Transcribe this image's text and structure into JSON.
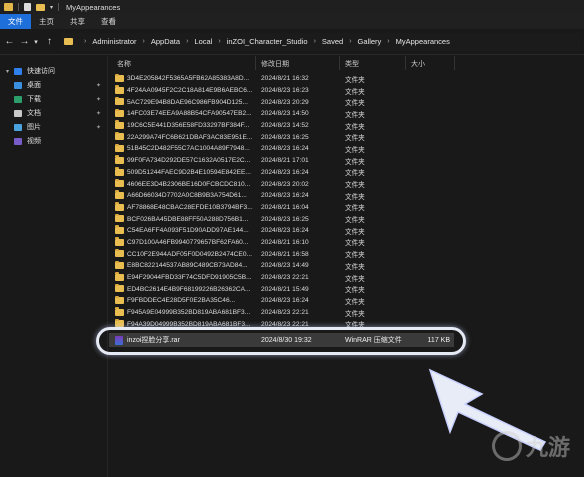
{
  "window": {
    "title": "MyAppearances"
  },
  "ribbon": {
    "tabs": [
      "文件",
      "主页",
      "共享",
      "查看"
    ],
    "active": 0
  },
  "breadcrumbs": [
    "Administrator",
    "AppData",
    "Local",
    "inZOI_Character_Studio",
    "Saved",
    "Gallery",
    "MyAppearances"
  ],
  "sidebar": {
    "quick_access": "快速访问",
    "items": [
      "桌面",
      "下载",
      "文档",
      "图片",
      "视频"
    ]
  },
  "columns": {
    "name": "名称",
    "date": "修改日期",
    "type": "类型",
    "size": "大小"
  },
  "files": [
    {
      "name": "3D4E205842F5365A5FB62A85383A8D...",
      "date": "2024/8/21 16:32",
      "type": "文件夹"
    },
    {
      "name": "4F24AA0945F2C2C18A814E9B6AEBC6...",
      "date": "2024/8/23 16:23",
      "type": "文件夹"
    },
    {
      "name": "5AC729E94B8DAE96C986FB904D125...",
      "date": "2024/8/23 20:29",
      "type": "文件夹"
    },
    {
      "name": "14FC03E74EEA9A88B54CFA90547EB2...",
      "date": "2024/8/23 14:50",
      "type": "文件夹"
    },
    {
      "name": "19C6C5E441D356E58FD33297BF384F...",
      "date": "2024/8/23 14:52",
      "type": "文件夹"
    },
    {
      "name": "22A299A74FC6B621DBAF3AC83E951E...",
      "date": "2024/8/23 16:25",
      "type": "文件夹"
    },
    {
      "name": "51B45C2D482F55C7AC1004A89F7948...",
      "date": "2024/8/23 16:24",
      "type": "文件夹"
    },
    {
      "name": "99F0FA734D292DE57C1632A0517E2C...",
      "date": "2024/8/21 17:01",
      "type": "文件夹"
    },
    {
      "name": "509D51244FAEC9D2B4E10594E842EE...",
      "date": "2024/8/23 16:24",
      "type": "文件夹"
    },
    {
      "name": "4606EE3D4B2306BE16D0FCBCDC810...",
      "date": "2024/8/23 20:02",
      "type": "文件夹"
    },
    {
      "name": "A66D66034D7702A0C8B9B3A754D61...",
      "date": "2024/8/23 16:24",
      "type": "文件夹"
    },
    {
      "name": "AF78868E48CBAC28EFDE10B3794BF3...",
      "date": "2024/8/21 16:04",
      "type": "文件夹"
    },
    {
      "name": "BCF026BA45DBE88FF50A288D756B1...",
      "date": "2024/8/23 16:25",
      "type": "文件夹"
    },
    {
      "name": "C54EA6FF4A093F51D90ADD97AE144...",
      "date": "2024/8/23 16:24",
      "type": "文件夹"
    },
    {
      "name": "C97D100A46FB9940779657BF62FA60...",
      "date": "2024/8/21 16:10",
      "type": "文件夹"
    },
    {
      "name": "CC10F2E944ADF05F0D0492B2474CE0...",
      "date": "2024/8/21 16:58",
      "type": "文件夹"
    },
    {
      "name": "E8BC822144537AB89C489CB73AD84...",
      "date": "2024/8/23 14:49",
      "type": "文件夹"
    },
    {
      "name": "E94F29044FBD33F74C5DFD91905C5B...",
      "date": "2024/8/23 22:21",
      "type": "文件夹"
    },
    {
      "name": "ED4BC2614E4B9F68199226B26362CA...",
      "date": "2024/8/21 15:49",
      "type": "文件夹"
    },
    {
      "name": "F9FBDDEC4E28D5F0E2BA35C46...",
      "date": "2024/8/23 16:24",
      "type": "文件夹"
    },
    {
      "name": "F945A9E04999B352BD819ABA681BF3...",
      "date": "2024/8/23 22:21",
      "type": "文件夹"
    },
    {
      "name": "F94A39D04999B352BD819ABA681BF3...",
      "date": "2024/8/23 22:21",
      "type": "文件夹"
    }
  ],
  "archive": {
    "name": "inzoi捏脸分享.rar",
    "date": "2024/8/30 19:32",
    "type": "WinRAR 压缩文件",
    "size": "117 KB"
  },
  "watermark": {
    "text": "九游"
  },
  "colors": {
    "accent": "#1e6fd9",
    "folder": "#e9bd4f",
    "highlight": "#3a3a3a"
  }
}
